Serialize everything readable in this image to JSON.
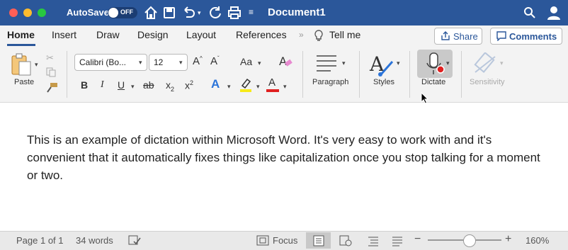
{
  "titlebar": {
    "autosave_label": "AutoSave",
    "autosave_state": "OFF",
    "document_title": "Document1",
    "colors": {
      "bg": "#2b579a",
      "close": "#ff5f57",
      "minimize": "#febc2e",
      "zoom": "#28c840"
    }
  },
  "tabs": [
    "Home",
    "Insert",
    "Draw",
    "Design",
    "Layout",
    "References"
  ],
  "active_tab": "Home",
  "tell_me": "Tell me",
  "share_label": "Share",
  "comments_label": "Comments",
  "ribbon": {
    "paste_label": "Paste",
    "font_name": "Calibri (Bo...",
    "font_size": "12",
    "paragraph_label": "Paragraph",
    "styles_label": "Styles",
    "dictate_label": "Dictate",
    "sensitivity_label": "Sensitivity"
  },
  "document": {
    "text": "This is an example of dictation within Microsoft Word. It's very easy to work with and it's convenient that it automatically fixes things like capitalization once you stop talking for a moment or two."
  },
  "status": {
    "page": "Page 1 of 1",
    "words": "34 words",
    "focus_label": "Focus",
    "zoom": "160%"
  }
}
